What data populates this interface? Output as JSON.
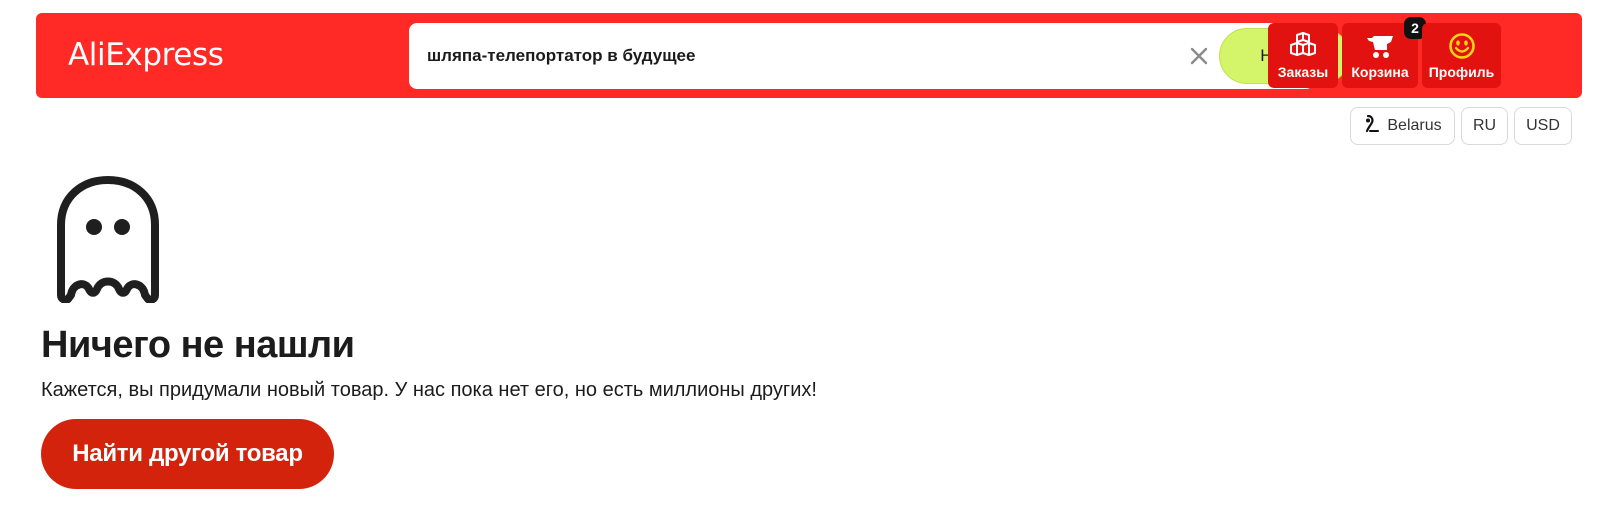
{
  "header": {
    "logo_text": "AliExpress",
    "search": {
      "value": "шляпа-телепортатор в будущее",
      "search_button_label": "Найти"
    },
    "nav": {
      "orders_label": "Заказы",
      "cart_label": "Корзина",
      "cart_count": "2",
      "profile_label": "Профиль"
    }
  },
  "locale": {
    "country": "Belarus",
    "language": "RU",
    "currency": "USD"
  },
  "empty_state": {
    "title": "Ничего не нашли",
    "subtitle": "Кажется, вы придумали новый товар. У нас пока нет его, но есть миллионы других!",
    "button_label": "Найти другой товар"
  },
  "colors": {
    "header_bg": "#ff2a25",
    "nav_button_bg": "#e1120f",
    "search_button_bg": "#d4f56a",
    "cta_bg": "#d4230c"
  },
  "icons": {
    "orders": "boxes-icon",
    "cart": "cart-icon",
    "profile": "smiley-icon",
    "country": "location-pin-icon",
    "clear": "close-icon",
    "empty": "ghost-icon"
  }
}
